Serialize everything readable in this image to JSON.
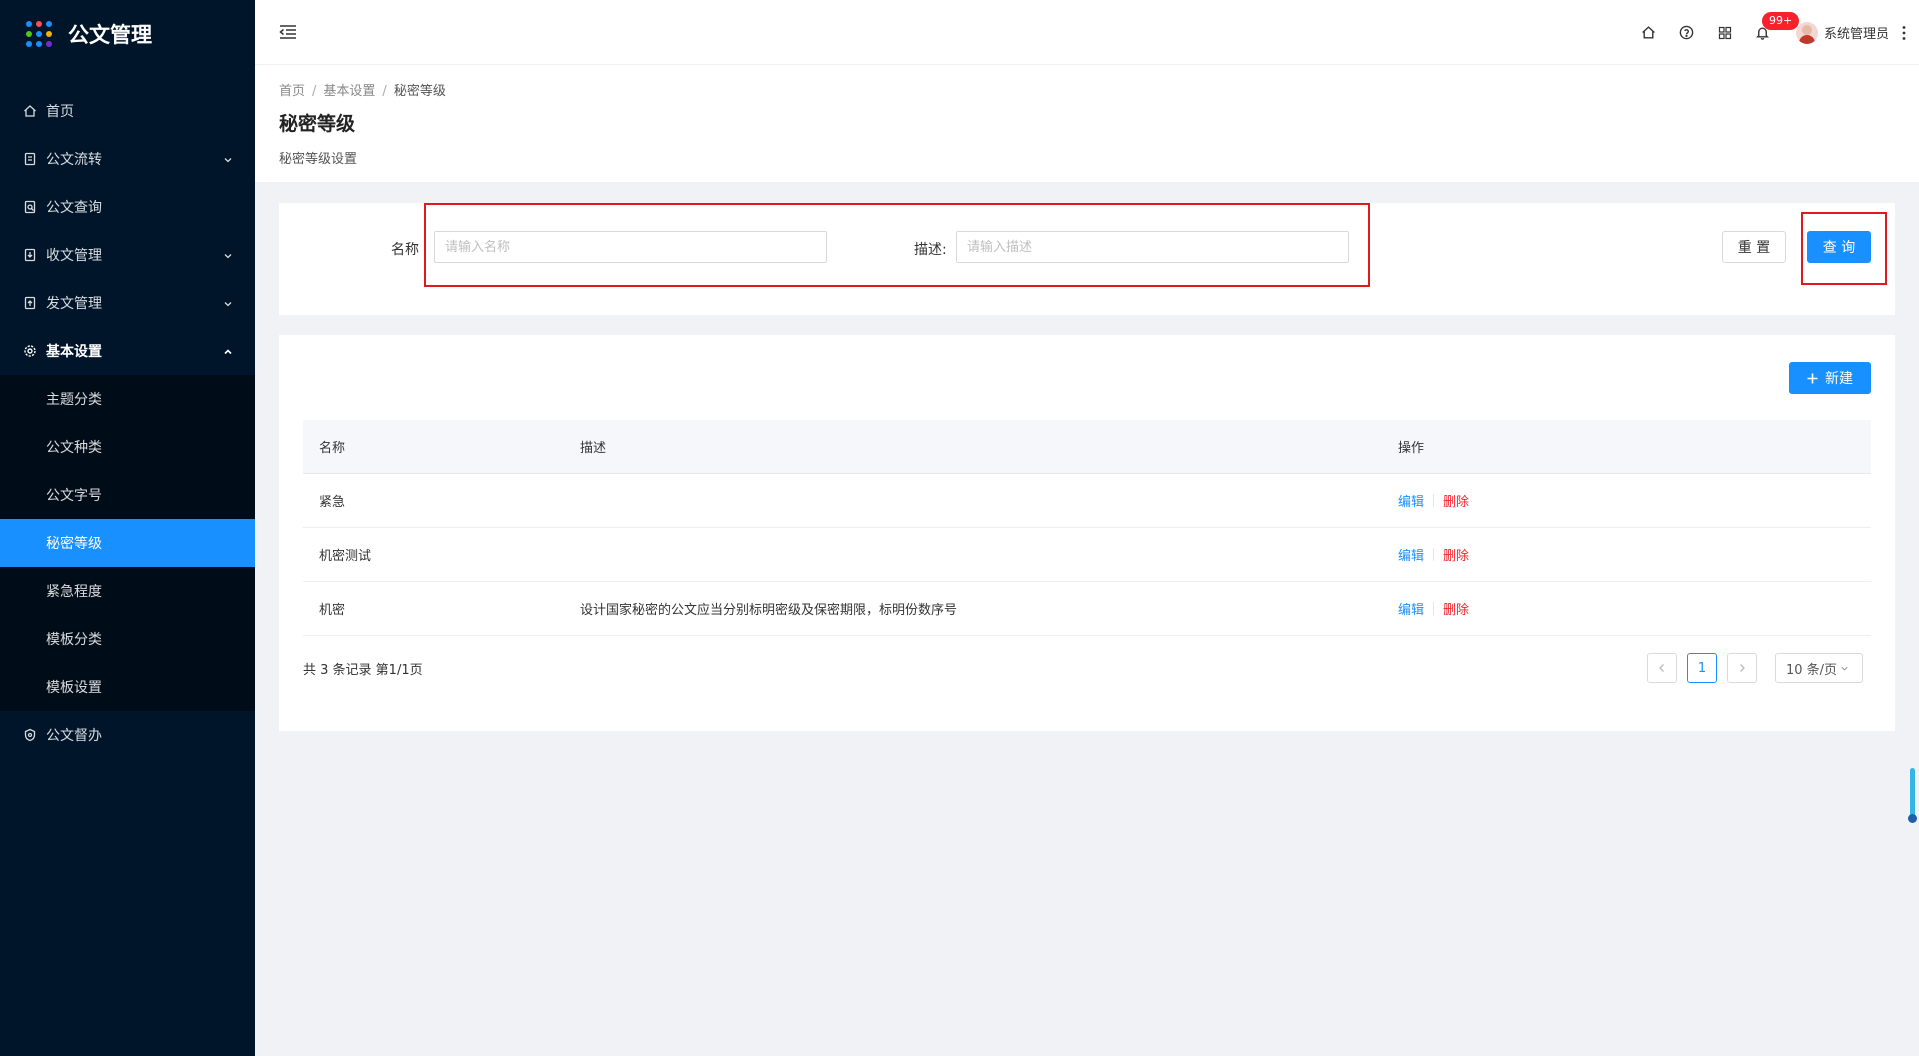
{
  "app": {
    "title": "公文管理"
  },
  "colors": {
    "sidebar_bg": "#001529",
    "primary": "#1890ff",
    "danger": "#f5222d",
    "highlight_box": "#e0191f"
  },
  "sidebar": {
    "items": [
      {
        "label": "首页",
        "icon": "home-icon"
      },
      {
        "label": "公文流转",
        "icon": "document-icon",
        "has_children": true
      },
      {
        "label": "公文查询",
        "icon": "document-search-icon"
      },
      {
        "label": "收文管理",
        "icon": "inbox-document-icon",
        "has_children": true
      },
      {
        "label": "发文管理",
        "icon": "send-document-icon",
        "has_children": true
      },
      {
        "label": "基本设置",
        "icon": "gear-icon",
        "has_children": true,
        "expanded": true
      },
      {
        "label": "公文督办",
        "icon": "supervise-icon"
      }
    ],
    "submenu": [
      "主题分类",
      "公文种类",
      "公文字号",
      "秘密等级",
      "紧急程度",
      "模板分类",
      "模板设置"
    ],
    "active_submenu": "秘密等级"
  },
  "header": {
    "icons": [
      "menu-collapse-icon",
      "home-icon",
      "help-icon",
      "apps-icon",
      "bell-icon"
    ],
    "notification_badge": "99+",
    "username": "系统管理员"
  },
  "breadcrumb": {
    "items": [
      "首页",
      "基本设置",
      "秘密等级"
    ]
  },
  "page": {
    "title": "秘密等级",
    "subtitle": "秘密等级设置"
  },
  "search": {
    "name_label": "名称",
    "name_placeholder": "请输入名称",
    "desc_label": "描述:",
    "desc_placeholder": "请输入描述",
    "reset_label": "重 置",
    "query_label": "查 询"
  },
  "toolbar": {
    "new_label": "新建"
  },
  "table": {
    "columns": [
      "名称",
      "描述",
      "操作"
    ],
    "rows": [
      {
        "name": "紧急",
        "desc": ""
      },
      {
        "name": "机密测试",
        "desc": ""
      },
      {
        "name": "机密",
        "desc": "设计国家秘密的公文应当分别标明密级及保密期限，标明份数序号"
      }
    ],
    "edit_label": "编辑",
    "delete_label": "删除"
  },
  "pagination": {
    "summary": "共 3 条记录 第1/1页",
    "current_page": "1",
    "page_size": "10 条/页"
  }
}
